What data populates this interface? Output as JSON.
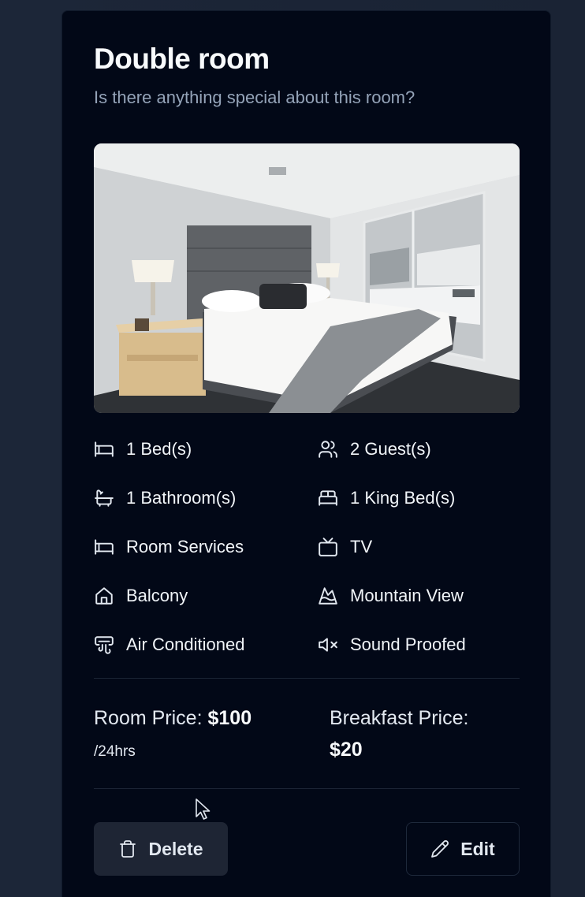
{
  "room": {
    "title": "Double room",
    "subtitle": "Is there anything special about this room?"
  },
  "amenities": [
    {
      "icon": "bed-icon",
      "label": "1 Bed(s)"
    },
    {
      "icon": "users-icon",
      "label": "2 Guest(s)"
    },
    {
      "icon": "bath-icon",
      "label": "1 Bathroom(s)"
    },
    {
      "icon": "bed-double-icon",
      "label": "1 King Bed(s)"
    },
    {
      "icon": "bed-icon",
      "label": "Room Services"
    },
    {
      "icon": "tv-icon",
      "label": "TV"
    },
    {
      "icon": "home-icon",
      "label": "Balcony"
    },
    {
      "icon": "mountain-icon",
      "label": "Mountain View"
    },
    {
      "icon": "air-vent-icon",
      "label": "Air Conditioned"
    },
    {
      "icon": "volume-mute-icon",
      "label": "Sound Proofed"
    }
  ],
  "pricing": {
    "room_label": "Room Price:",
    "room_value": "$100",
    "room_unit": "/24hrs",
    "breakfast_label": "Breakfast Price:",
    "breakfast_value": "$20"
  },
  "actions": {
    "delete_label": "Delete",
    "edit_label": "Edit"
  },
  "colors": {
    "card_bg": "#020817",
    "page_bg": "#1b2536",
    "muted_text": "#94a3b8"
  }
}
